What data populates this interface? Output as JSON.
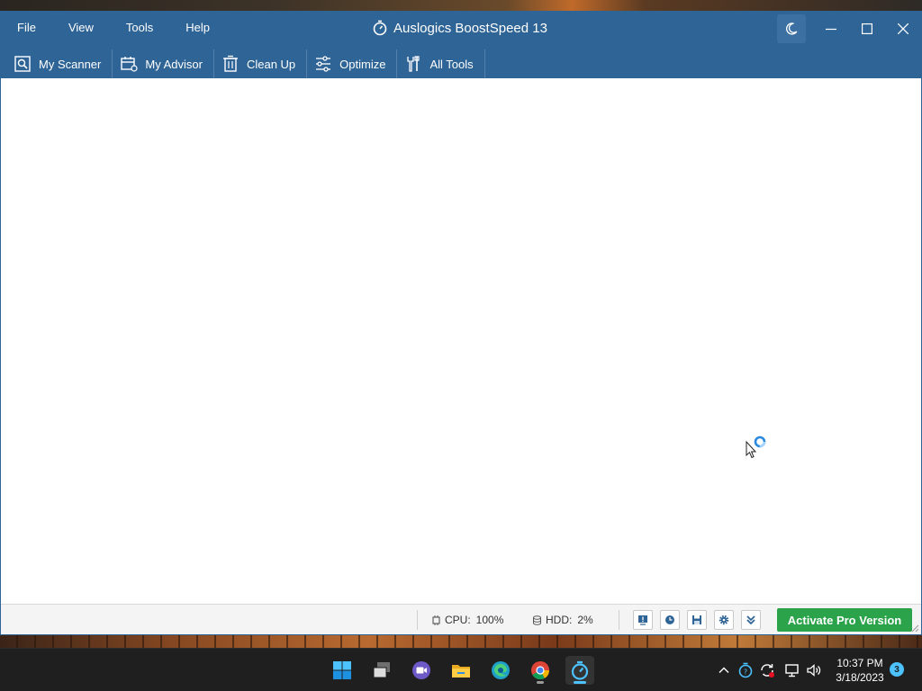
{
  "window": {
    "title": "Auslogics BoostSpeed 13",
    "menu": [
      "File",
      "View",
      "Tools",
      "Help"
    ],
    "toolbar": [
      {
        "label": "My Scanner",
        "icon": "scanner-icon"
      },
      {
        "label": "My Advisor",
        "icon": "advisor-icon"
      },
      {
        "label": "Clean Up",
        "icon": "trash-icon"
      },
      {
        "label": "Optimize",
        "icon": "sliders-icon"
      },
      {
        "label": "All Tools",
        "icon": "tools-icon"
      }
    ],
    "controls": [
      "moon-icon",
      "minimize-icon",
      "maximize-icon",
      "close-icon"
    ]
  },
  "status": {
    "cpu_label": "CPU:",
    "cpu_value": "100%",
    "hdd_label": "HDD:",
    "hdd_value": "2%",
    "buttons": [
      "report-icon",
      "clock-icon",
      "save-icon",
      "gear-icon",
      "chevron-down-icon"
    ],
    "activate_label": "Activate Pro Version"
  },
  "taskbar": {
    "apps": [
      "windows-start-icon",
      "task-view-icon",
      "teams-chat-icon",
      "file-explorer-icon",
      "edge-icon",
      "chrome-icon",
      "boostspeed-icon"
    ],
    "tray": [
      "chevron-up-icon",
      "boostspeed-tray-icon",
      "sync-icon",
      "network-icon",
      "volume-icon"
    ],
    "time": "10:37 PM",
    "date": "3/18/2023",
    "notification_count": "3"
  },
  "colors": {
    "title_bar": "#2f6496",
    "activate_button": "#2aa34a",
    "taskbar": "#1f1f1f",
    "accent": "#4cc2ff"
  }
}
